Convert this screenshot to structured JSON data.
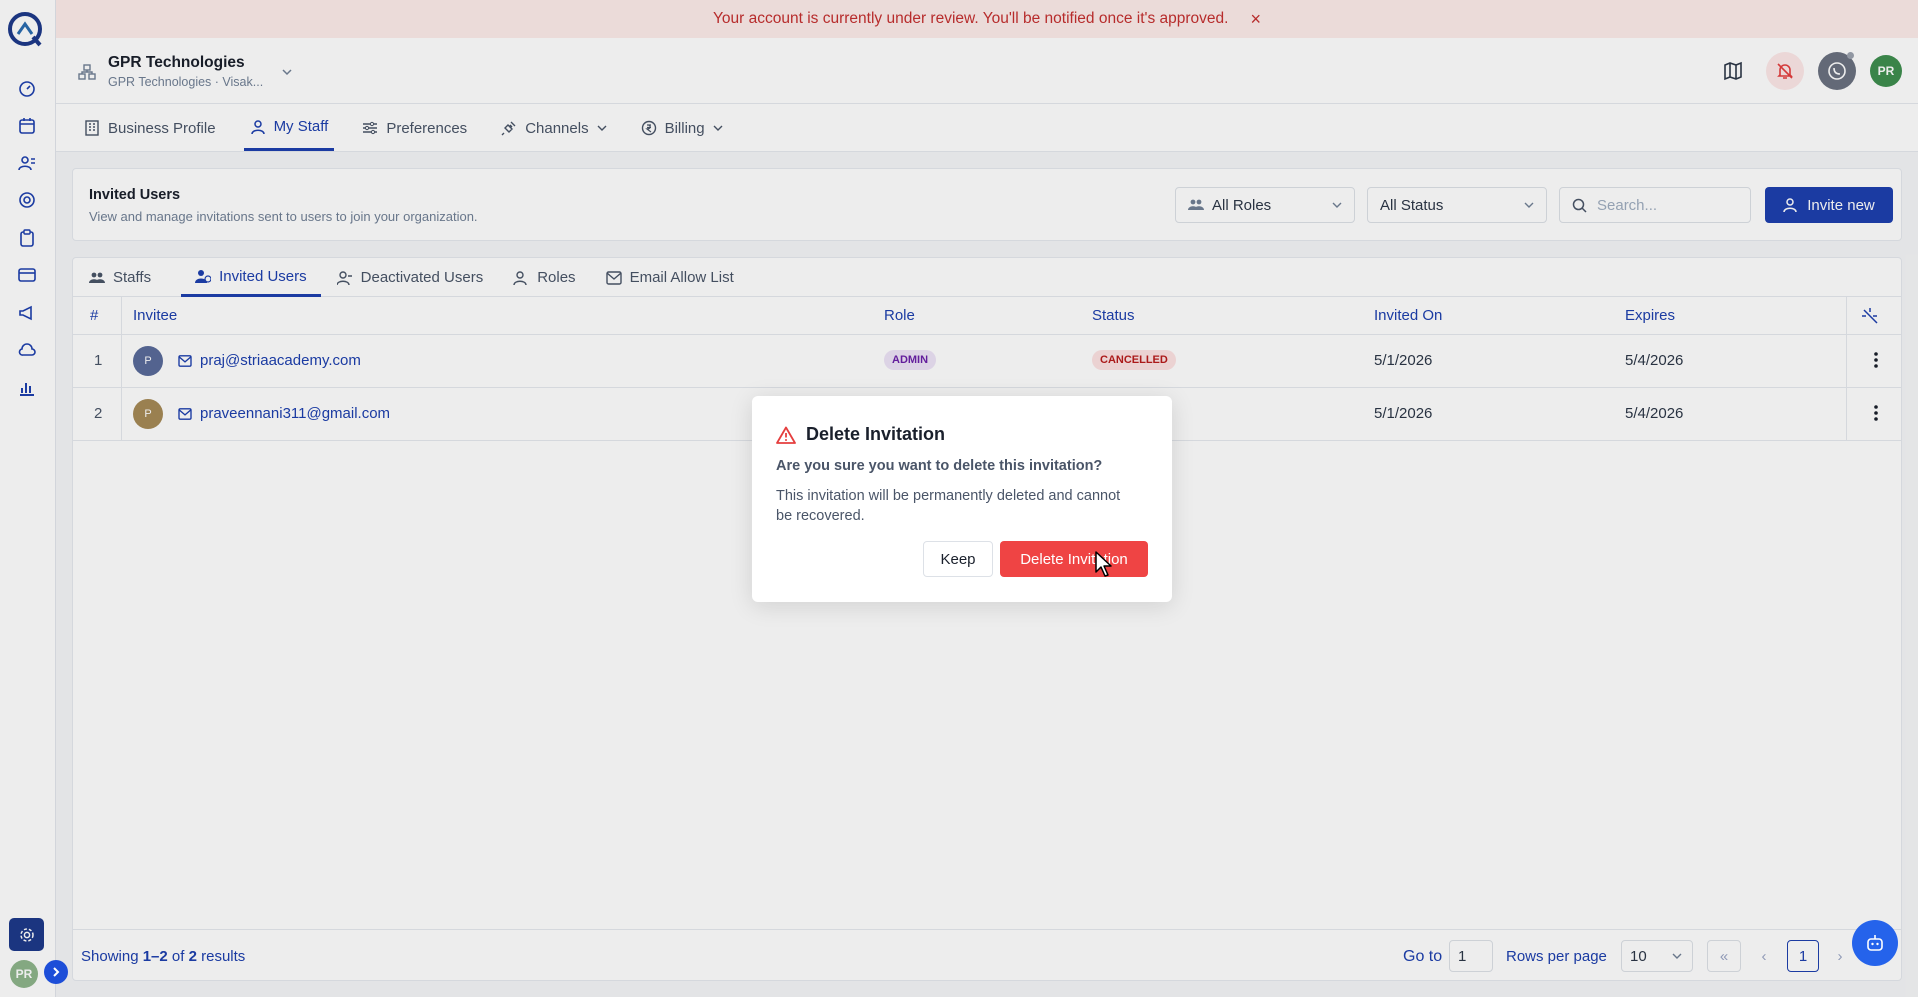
{
  "banner": {
    "message": "Your account is currently under review. You'll be notified once it's approved.",
    "close_icon": "×"
  },
  "org": {
    "name": "GPR Technologies",
    "sub": "GPR Technologies · Visak..."
  },
  "user": {
    "initials": "PR"
  },
  "nav": {
    "items": [
      {
        "label": "Business Profile"
      },
      {
        "label": "My Staff"
      },
      {
        "label": "Preferences"
      },
      {
        "label": "Channels"
      },
      {
        "label": "Billing"
      }
    ]
  },
  "section": {
    "title": "Invited Users",
    "description": "View and manage invitations sent to users to join your organization."
  },
  "filters": {
    "roles": "All Roles",
    "status": "All Status",
    "search_placeholder": "Search...",
    "invite_label": "Invite new"
  },
  "tabs": [
    {
      "label": "Staffs"
    },
    {
      "label": "Invited Users"
    },
    {
      "label": "Deactivated Users"
    },
    {
      "label": "Roles"
    },
    {
      "label": "Email Allow List"
    }
  ],
  "table": {
    "columns": [
      "#",
      "Invitee",
      "Role",
      "Status",
      "Invited On",
      "Expires"
    ],
    "rows": [
      {
        "num": "1",
        "initial": "P",
        "email": "praj@striaacademy.com",
        "role": "ADMIN",
        "status": "CANCELLED",
        "invited_on": "5/1/2026",
        "expires": "5/4/2026"
      },
      {
        "num": "2",
        "initial": "P",
        "email": "praveennani311@gmail.com",
        "role": "",
        "status": "",
        "invited_on": "5/1/2026",
        "expires": "5/4/2026"
      }
    ]
  },
  "footer": {
    "showing_prefix": "Showing ",
    "range": "1–2",
    "of": " of ",
    "total": "2",
    "suffix": " results",
    "goto_label": "Go to",
    "goto_value": "1",
    "rows_label": "Rows per page",
    "rows_value": "10",
    "page": "1"
  },
  "modal": {
    "title": "Delete Invitation",
    "question": "Are you sure you want to delete this invitation?",
    "description": "This invitation will be permanently deleted and cannot be recovered.",
    "keep_label": "Keep",
    "delete_label": "Delete Invitation"
  },
  "colors": {
    "primary": "#1e40af",
    "danger": "#ef4444",
    "banner_bg": "#fdecea",
    "admin_pill": "#ede3f7",
    "cancelled_pill": "#fde2e2"
  }
}
